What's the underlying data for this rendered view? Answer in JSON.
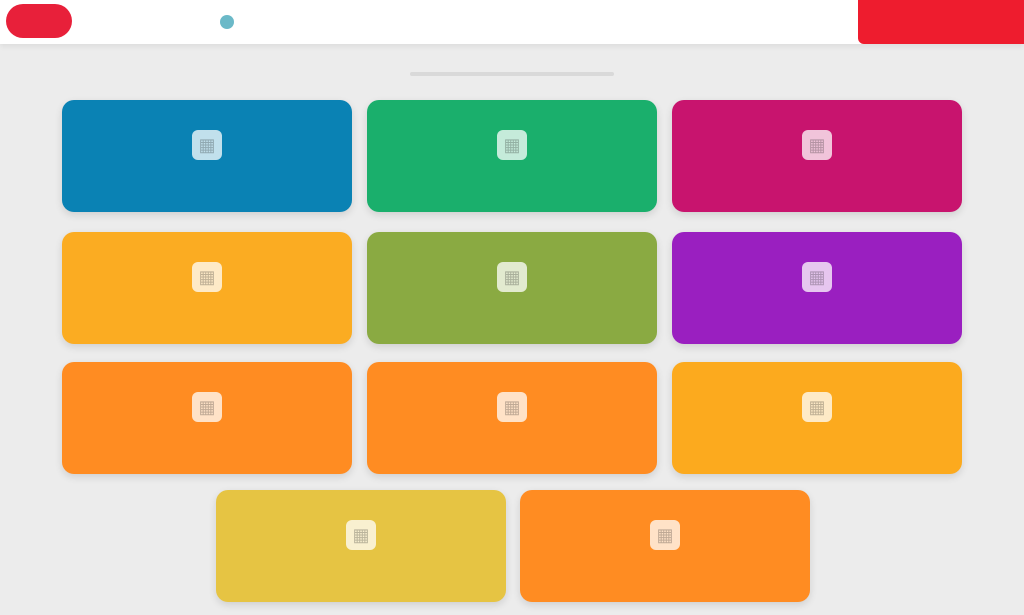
{
  "header": {
    "logo_text": "",
    "nav": [
      {
        "label": "",
        "icon": ""
      },
      {
        "label": "",
        "icon": ""
      },
      {
        "label": "",
        "icon": ""
      },
      {
        "label": "",
        "icon": "circle-icon"
      }
    ],
    "cta_label": ""
  },
  "page": {
    "title": ""
  },
  "tiles": [
    {
      "label": "",
      "color": "#0a82b4",
      "icon": "grid-icon"
    },
    {
      "label": "",
      "color": "#1aaf6c",
      "icon": "grid-icon"
    },
    {
      "label": "",
      "color": "#c8146e",
      "icon": "grid-icon"
    },
    {
      "label": "",
      "color": "#fbac22",
      "icon": "grid-icon"
    },
    {
      "label": "",
      "color": "#8aaa42",
      "icon": "grid-icon"
    },
    {
      "label": "",
      "color": "#9a1fc0",
      "icon": "grid-icon"
    },
    {
      "label": "",
      "color": "#ff8c22",
      "icon": "grid-icon"
    },
    {
      "label": "",
      "color": "#ff8c22",
      "icon": "grid-icon"
    },
    {
      "label": "",
      "color": "#fcaa1e",
      "icon": "grid-icon"
    },
    {
      "label": "",
      "color": "#e6c443",
      "icon": "grid-icon"
    },
    {
      "label": "",
      "color": "#ff8c22",
      "icon": "grid-icon"
    }
  ],
  "colors": {
    "brand_red": "#ee1c2e",
    "background": "#ececec"
  }
}
